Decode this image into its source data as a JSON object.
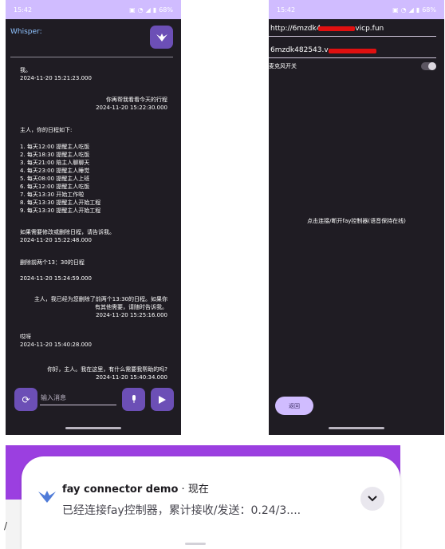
{
  "colors": {
    "accent": "#6c4fb6",
    "statusbar": "#d0bcff",
    "background": "#1f1c23"
  },
  "left_screen": {
    "status": {
      "time": "15:42",
      "battery": "68%"
    },
    "whisper_label": "Whisper:",
    "brand_icon": "fay-logo-icon",
    "messages": [
      {
        "side": "left",
        "text": "我。",
        "time": "2024-11-20 15:21:23.000"
      },
      {
        "side": "right",
        "text": "你再帮我看看今天的行程",
        "time": "2024-11-20 15:22:30.000"
      },
      {
        "side": "left",
        "text": "主人，你的日程如下:",
        "time": ""
      },
      {
        "side": "left",
        "text": "1. 每天12:00 提醒主人吃饭",
        "time": ""
      },
      {
        "side": "left",
        "text": "2. 每天18:30 提醒主人吃饭",
        "time": ""
      },
      {
        "side": "left",
        "text": "3. 每天21:00 陪主人聊聊天",
        "time": ""
      },
      {
        "side": "left",
        "text": "4. 每天23:00 提醒主人睡觉",
        "time": ""
      },
      {
        "side": "left",
        "text": "5. 每天08:00 提醒主人上班",
        "time": ""
      },
      {
        "side": "left",
        "text": "6. 每天12:00 提醒主人吃饭",
        "time": ""
      },
      {
        "side": "left",
        "text": "7. 每天13:30 开始工作啦",
        "time": ""
      },
      {
        "side": "left",
        "text": "8. 每天13:30 提醒主人开始工程",
        "time": ""
      },
      {
        "side": "left",
        "text": "9. 每天13:30 提醒主人开始工程",
        "time": ""
      },
      {
        "side": "left",
        "text": "如果需要修改或删除日程，请告诉我。",
        "time": "2024-11-20 15:22:48.000"
      },
      {
        "side": "left",
        "text": "删除前两个13：30的日程",
        "time": ""
      },
      {
        "side": "left",
        "text": "",
        "time": "2024-11-20 15:24:59.000"
      },
      {
        "side": "right",
        "text": "主人，我已经为您删除了前两个13:30的日程。如果你",
        "time": ""
      },
      {
        "side": "right",
        "text": "有其他需要，请随时告诉我。",
        "time": "2024-11-20 15:25:16.000"
      },
      {
        "side": "left",
        "text": "哎呀",
        "time": "2024-11-20 15:40:28.000"
      },
      {
        "side": "right",
        "text": "你好，主人。我在这里，有什么需要我帮助的吗?",
        "time": "2024-11-20 15:40:34.000"
      }
    ],
    "input_placeholder": "输入消息",
    "buttons": {
      "refresh": "refresh-icon",
      "mic": "mic-icon",
      "send": "send-icon"
    }
  },
  "right_screen": {
    "status": {
      "time": "15:42",
      "battery": "68%"
    },
    "server_url_prefix": "http://6mzdk4",
    "server_url_suffix": ".vicp.fun",
    "device_id_prefix": "6mzdk482543.v",
    "mic_switch_label": "麦克风开关",
    "mic_switch_on": true,
    "center_hint": "点击连接/断开fay控制器(语音保持在线)",
    "back_button": "返回"
  },
  "notification": {
    "app_name": "fay connector demo",
    "separator": "·",
    "when": "现在",
    "body": "已经连接fay控制器，累计接收/发送：0.24/3....",
    "left_fragment": "/",
    "expand_icon": "chevron-down-icon",
    "app_icon": "fay-logo-icon"
  }
}
